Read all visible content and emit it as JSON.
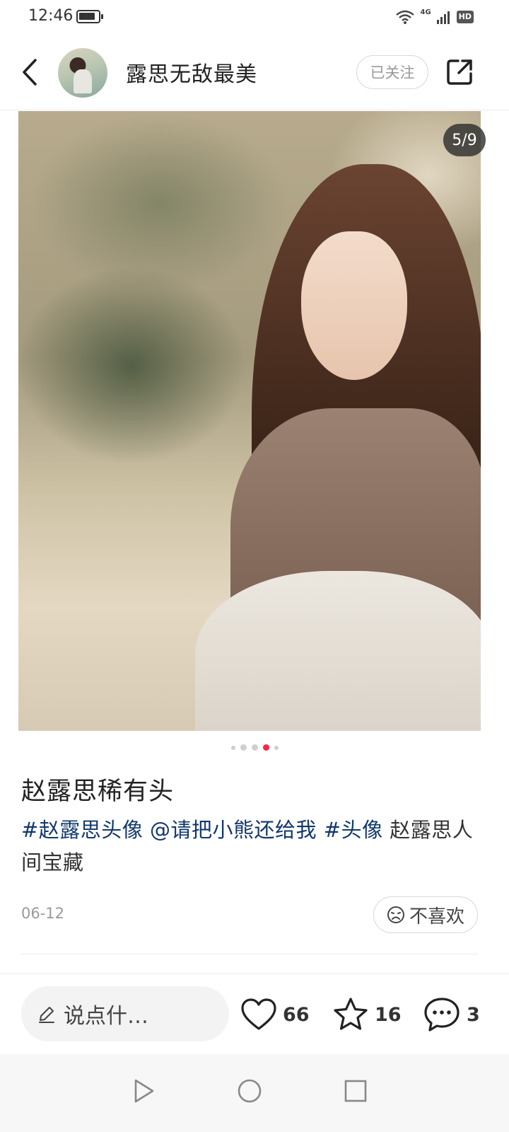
{
  "status_bar": {
    "time": "12:46",
    "network": "4G",
    "hd_label": "HD"
  },
  "header": {
    "author_name": "露思无敌最美",
    "follow_label": "已关注"
  },
  "media": {
    "counter": "5/9",
    "current_index": 4,
    "dots_shown": 5
  },
  "post": {
    "title": "赵露思稀有头",
    "body_segments": [
      {
        "text": "#赵露思头像",
        "type": "tag"
      },
      {
        "text": " ",
        "type": "text"
      },
      {
        "text": "@请把小熊还给我",
        "type": "tag"
      },
      {
        "text": " ",
        "type": "text"
      },
      {
        "text": "#头像",
        "type": "tag"
      },
      {
        "text": " 赵露思人间宝藏",
        "type": "text"
      }
    ],
    "date": "06-12",
    "dislike_label": "不喜欢"
  },
  "action_bar": {
    "comment_placeholder": "说点什…",
    "likes": "66",
    "favorites": "16",
    "comments": "3"
  },
  "colors": {
    "accent": "#ff2442",
    "tag": "#13386c",
    "divider": "#ececec"
  },
  "icons": [
    "back-icon",
    "share-icon",
    "wifi-icon",
    "signal-icon",
    "battery-icon",
    "dislike-face-icon",
    "pencil-icon",
    "heart-icon",
    "star-icon",
    "comment-bubble-icon",
    "nav-back-icon",
    "nav-home-icon",
    "nav-recents-icon"
  ]
}
